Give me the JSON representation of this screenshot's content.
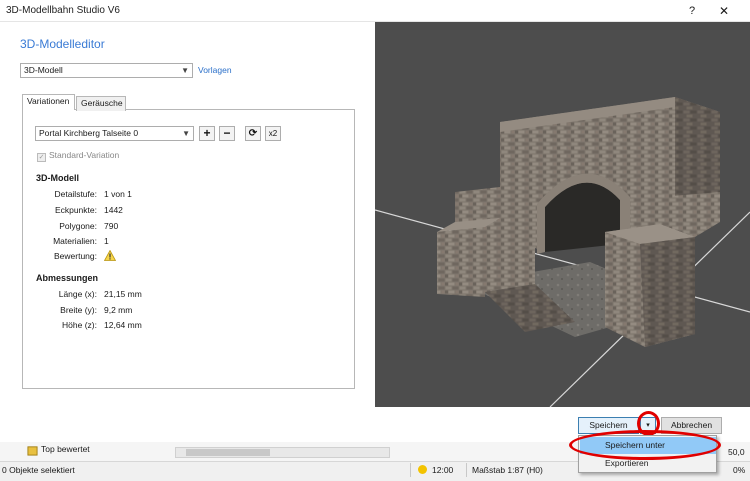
{
  "window": {
    "title": "3D-Modellbahn Studio V6",
    "help": "?",
    "close": "✕"
  },
  "editor": {
    "heading": "3D-Modelleditor",
    "model_select": "3D-Modell",
    "templates_link": "Vorlagen"
  },
  "tabs": [
    "Variationen",
    "Geräusche"
  ],
  "variation": {
    "select": "Portal Kirchberg Talseite 0",
    "add": "+",
    "remove": "−",
    "refresh": "⟳",
    "duplicate": "x2",
    "standard_label": "Standard-Variation"
  },
  "model_section": {
    "heading": "3D-Modell",
    "rows": [
      {
        "label": "Detailstufe:",
        "value": "1 von 1"
      },
      {
        "label": "Eckpunkte:",
        "value": "1442"
      },
      {
        "label": "Polygone:",
        "value": "790"
      },
      {
        "label": "Materialien:",
        "value": "1"
      },
      {
        "label": "Bewertung:",
        "value": ""
      }
    ],
    "rating_icon": "warning-icon"
  },
  "dims_section": {
    "heading": "Abmessungen",
    "rows": [
      {
        "label": "Länge (x):",
        "value": "21,15 mm"
      },
      {
        "label": "Breite (y):",
        "value": "9,2 mm"
      },
      {
        "label": "Höhe (z):",
        "value": "12,64 mm"
      }
    ]
  },
  "buttons": {
    "save": "Speichern",
    "save_menu_arrow": "▾",
    "cancel": "Abbrechen"
  },
  "save_menu": {
    "save_as": "Speichern unter",
    "export": "Exportieren"
  },
  "background": {
    "top_rated": "Top bewertet",
    "status_left": "0 Objekte selektiert",
    "time": "12:00",
    "scale": "Maßstab 1:87 (H0)",
    "status_right": "0%",
    "zoom": "50,0"
  },
  "colors": {
    "accent": "#3a7bd5",
    "highlight_ring": "#e00000",
    "viewport_bg": "#4d4d4d",
    "menu_selected": "#91c9f7"
  }
}
